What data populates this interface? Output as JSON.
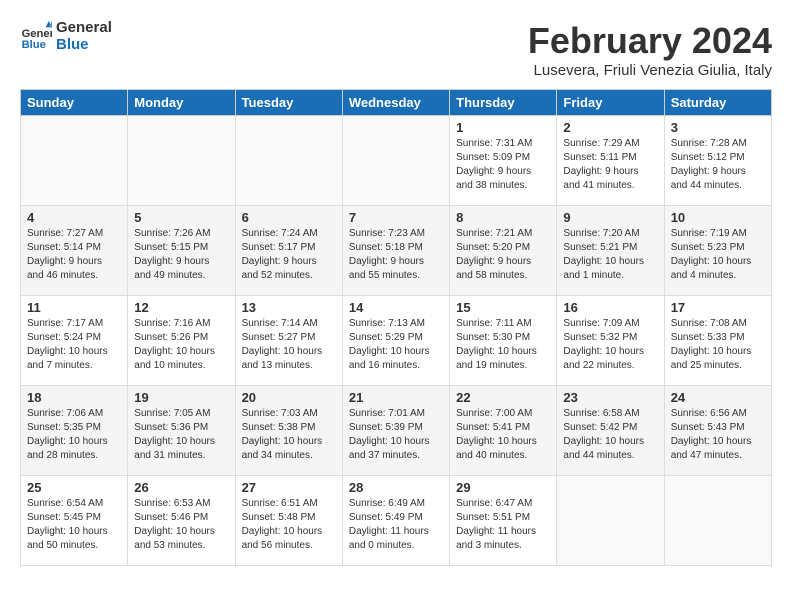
{
  "header": {
    "logo_line1": "General",
    "logo_line2": "Blue",
    "month_title": "February 2024",
    "subtitle": "Lusevera, Friuli Venezia Giulia, Italy"
  },
  "days_of_week": [
    "Sunday",
    "Monday",
    "Tuesday",
    "Wednesday",
    "Thursday",
    "Friday",
    "Saturday"
  ],
  "weeks": [
    [
      {
        "day": "",
        "info": ""
      },
      {
        "day": "",
        "info": ""
      },
      {
        "day": "",
        "info": ""
      },
      {
        "day": "",
        "info": ""
      },
      {
        "day": "1",
        "info": "Sunrise: 7:31 AM\nSunset: 5:09 PM\nDaylight: 9 hours\nand 38 minutes."
      },
      {
        "day": "2",
        "info": "Sunrise: 7:29 AM\nSunset: 5:11 PM\nDaylight: 9 hours\nand 41 minutes."
      },
      {
        "day": "3",
        "info": "Sunrise: 7:28 AM\nSunset: 5:12 PM\nDaylight: 9 hours\nand 44 minutes."
      }
    ],
    [
      {
        "day": "4",
        "info": "Sunrise: 7:27 AM\nSunset: 5:14 PM\nDaylight: 9 hours\nand 46 minutes."
      },
      {
        "day": "5",
        "info": "Sunrise: 7:26 AM\nSunset: 5:15 PM\nDaylight: 9 hours\nand 49 minutes."
      },
      {
        "day": "6",
        "info": "Sunrise: 7:24 AM\nSunset: 5:17 PM\nDaylight: 9 hours\nand 52 minutes."
      },
      {
        "day": "7",
        "info": "Sunrise: 7:23 AM\nSunset: 5:18 PM\nDaylight: 9 hours\nand 55 minutes."
      },
      {
        "day": "8",
        "info": "Sunrise: 7:21 AM\nSunset: 5:20 PM\nDaylight: 9 hours\nand 58 minutes."
      },
      {
        "day": "9",
        "info": "Sunrise: 7:20 AM\nSunset: 5:21 PM\nDaylight: 10 hours\nand 1 minute."
      },
      {
        "day": "10",
        "info": "Sunrise: 7:19 AM\nSunset: 5:23 PM\nDaylight: 10 hours\nand 4 minutes."
      }
    ],
    [
      {
        "day": "11",
        "info": "Sunrise: 7:17 AM\nSunset: 5:24 PM\nDaylight: 10 hours\nand 7 minutes."
      },
      {
        "day": "12",
        "info": "Sunrise: 7:16 AM\nSunset: 5:26 PM\nDaylight: 10 hours\nand 10 minutes."
      },
      {
        "day": "13",
        "info": "Sunrise: 7:14 AM\nSunset: 5:27 PM\nDaylight: 10 hours\nand 13 minutes."
      },
      {
        "day": "14",
        "info": "Sunrise: 7:13 AM\nSunset: 5:29 PM\nDaylight: 10 hours\nand 16 minutes."
      },
      {
        "day": "15",
        "info": "Sunrise: 7:11 AM\nSunset: 5:30 PM\nDaylight: 10 hours\nand 19 minutes."
      },
      {
        "day": "16",
        "info": "Sunrise: 7:09 AM\nSunset: 5:32 PM\nDaylight: 10 hours\nand 22 minutes."
      },
      {
        "day": "17",
        "info": "Sunrise: 7:08 AM\nSunset: 5:33 PM\nDaylight: 10 hours\nand 25 minutes."
      }
    ],
    [
      {
        "day": "18",
        "info": "Sunrise: 7:06 AM\nSunset: 5:35 PM\nDaylight: 10 hours\nand 28 minutes."
      },
      {
        "day": "19",
        "info": "Sunrise: 7:05 AM\nSunset: 5:36 PM\nDaylight: 10 hours\nand 31 minutes."
      },
      {
        "day": "20",
        "info": "Sunrise: 7:03 AM\nSunset: 5:38 PM\nDaylight: 10 hours\nand 34 minutes."
      },
      {
        "day": "21",
        "info": "Sunrise: 7:01 AM\nSunset: 5:39 PM\nDaylight: 10 hours\nand 37 minutes."
      },
      {
        "day": "22",
        "info": "Sunrise: 7:00 AM\nSunset: 5:41 PM\nDaylight: 10 hours\nand 40 minutes."
      },
      {
        "day": "23",
        "info": "Sunrise: 6:58 AM\nSunset: 5:42 PM\nDaylight: 10 hours\nand 44 minutes."
      },
      {
        "day": "24",
        "info": "Sunrise: 6:56 AM\nSunset: 5:43 PM\nDaylight: 10 hours\nand 47 minutes."
      }
    ],
    [
      {
        "day": "25",
        "info": "Sunrise: 6:54 AM\nSunset: 5:45 PM\nDaylight: 10 hours\nand 50 minutes."
      },
      {
        "day": "26",
        "info": "Sunrise: 6:53 AM\nSunset: 5:46 PM\nDaylight: 10 hours\nand 53 minutes."
      },
      {
        "day": "27",
        "info": "Sunrise: 6:51 AM\nSunset: 5:48 PM\nDaylight: 10 hours\nand 56 minutes."
      },
      {
        "day": "28",
        "info": "Sunrise: 6:49 AM\nSunset: 5:49 PM\nDaylight: 11 hours\nand 0 minutes."
      },
      {
        "day": "29",
        "info": "Sunrise: 6:47 AM\nSunset: 5:51 PM\nDaylight: 11 hours\nand 3 minutes."
      },
      {
        "day": "",
        "info": ""
      },
      {
        "day": "",
        "info": ""
      }
    ]
  ]
}
